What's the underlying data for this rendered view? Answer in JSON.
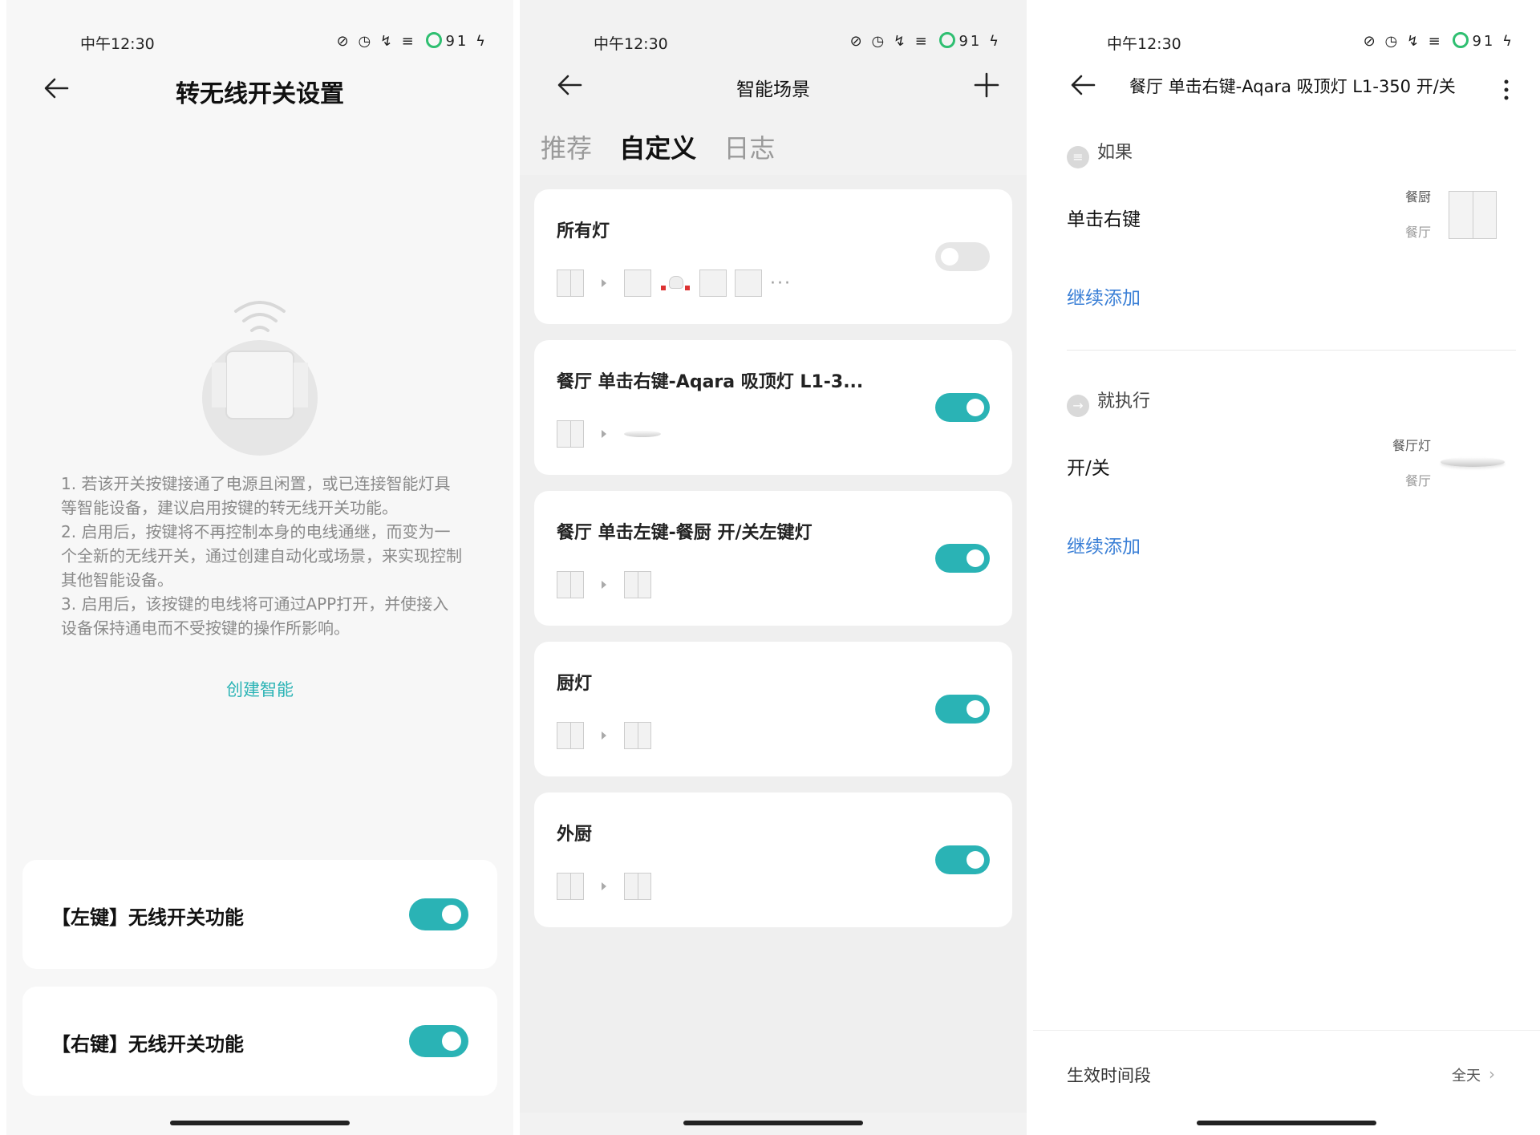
{
  "status": {
    "time": "中午12:30",
    "battery": "91"
  },
  "panel1": {
    "title": "转无线开关设置",
    "instructions": [
      "1. 若该开关按键接通了电源且闲置，或已连接智能灯具等智能设备，建议启用按键的转无线开关功能。",
      "2. 启用后，按键将不再控制本身的电线通继，而变为一个全新的无线开关，通过创建自动化或场景，来实现控制其他智能设备。",
      "3. 启用后，该按键的电线将可通过APP打开，并使接入设备保持通电而不受按键的操作所影响。"
    ],
    "create_link": "创建智能",
    "toggles": [
      {
        "label": "【左键】无线开关功能",
        "on": true
      },
      {
        "label": "【右键】无线开关功能",
        "on": true
      }
    ]
  },
  "panel2": {
    "title": "智能场景",
    "tabs": [
      {
        "label": "推荐",
        "active": false
      },
      {
        "label": "自定义",
        "active": true
      },
      {
        "label": "日志",
        "active": false
      }
    ],
    "scenes": [
      {
        "name": "所有灯",
        "on": false
      },
      {
        "name": "餐厅 单击右键-Aqara 吸顶灯 L1-3...",
        "on": true
      },
      {
        "name": "餐厅 单击左键-餐厨 开/关左键灯",
        "on": true
      },
      {
        "name": "厨灯",
        "on": true
      },
      {
        "name": "外厨",
        "on": true
      }
    ]
  },
  "panel3": {
    "title": "餐厅 单击右键-Aqara 吸顶灯 L1-350 开/关",
    "if_label": "如果",
    "trigger": {
      "label": "单击右键",
      "device": "餐厨",
      "room": "餐厅"
    },
    "add_more": "继续添加",
    "then_label": "就执行",
    "action": {
      "label": "开/关",
      "device": "餐厅灯",
      "room": "餐厅"
    },
    "add_more2": "继续添加",
    "period_label": "生效时间段",
    "period_value": "全天"
  }
}
